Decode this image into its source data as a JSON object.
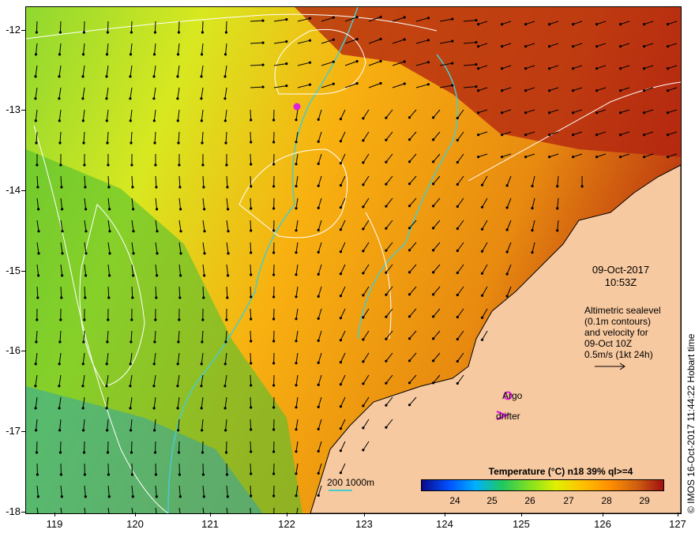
{
  "map": {
    "lon_ticks": [
      "119",
      "120",
      "121",
      "122",
      "123",
      "124",
      "125",
      "126",
      "127"
    ],
    "lat_ticks": [
      "-12",
      "-13",
      "-14",
      "-15",
      "-16",
      "-17",
      "-18"
    ],
    "land_color": "#f7c9a0",
    "coast_color": "#000000",
    "depth_contour_color": "#48cccc",
    "sealevel_contour_color": "#ffffff",
    "argo_color": "#e020e0",
    "drifter_color": "#e020e0"
  },
  "timestamp": {
    "date": "09-Oct-2017",
    "time": "10:53Z"
  },
  "altimetry_note": {
    "line1": "Altimetric sealevel",
    "line2": "(0.1m contours)",
    "line3": "and velocity for",
    "line4": "09-Oct 10Z",
    "line5": "0.5m/s (1kt 24h)"
  },
  "legend": {
    "argo": "Argo",
    "drifter": "drifter",
    "depth": "200  1000m"
  },
  "colorbar": {
    "title": "Temperature (°C) n18 39% ql>=4",
    "labels": [
      "24",
      "25",
      "26",
      "27",
      "28",
      "29"
    ],
    "colors": [
      "#0a0a8a",
      "#0050ff",
      "#00b0ff",
      "#20c860",
      "#80e020",
      "#e0f000",
      "#ffc000",
      "#ff9000",
      "#d06010",
      "#a01010"
    ]
  },
  "credit": "© IMOS 16-Oct-2017 11:44:22 Hobart time"
}
